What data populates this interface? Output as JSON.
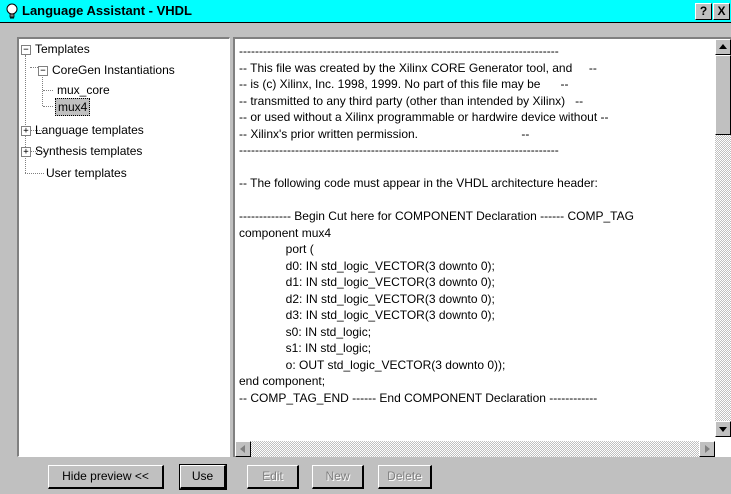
{
  "window": {
    "title": "Language Assistant - VHDL",
    "help_label": "?",
    "close_label": "X"
  },
  "tree": {
    "root": "Templates",
    "coregen": "CoreGen Instantiations",
    "mux_core": "mux_core",
    "mux4": "mux4",
    "language": "Language templates",
    "synthesis": "Synthesis templates",
    "user": "User templates",
    "expand_minus": "−",
    "expand_plus": "+"
  },
  "preview": {
    "lines": [
      "--------------------------------------------------------------------------------",
      "-- This file was created by the Xilinx CORE Generator tool, and     --",
      "-- is (c) Xilinx, Inc. 1998, 1999. No part of this file may be      --",
      "-- transmitted to any third party (other than intended by Xilinx)   --",
      "-- or used without a Xilinx programmable or hardwire device without --",
      "-- Xilinx's prior written permission.                               --",
      "--------------------------------------------------------------------------------",
      "",
      "-- The following code must appear in the VHDL architecture header:",
      "",
      "------------- Begin Cut here for COMPONENT Declaration ------ COMP_TAG",
      "component mux4",
      "              port (",
      "              d0: IN std_logic_VECTOR(3 downto 0);",
      "              d1: IN std_logic_VECTOR(3 downto 0);",
      "              d2: IN std_logic_VECTOR(3 downto 0);",
      "              d3: IN std_logic_VECTOR(3 downto 0);",
      "              s0: IN std_logic;",
      "              s1: IN std_logic;",
      "              o: OUT std_logic_VECTOR(3 downto 0));",
      "end component;",
      "-- COMP_TAG_END ------ End COMPONENT Declaration ------------"
    ]
  },
  "buttons": {
    "hide_preview": "Hide preview <<",
    "use": "Use",
    "edit": "Edit",
    "new": "New",
    "delete": "Delete"
  },
  "colors": {
    "titlebar": "#00ffff",
    "face": "#c0c0c0"
  }
}
